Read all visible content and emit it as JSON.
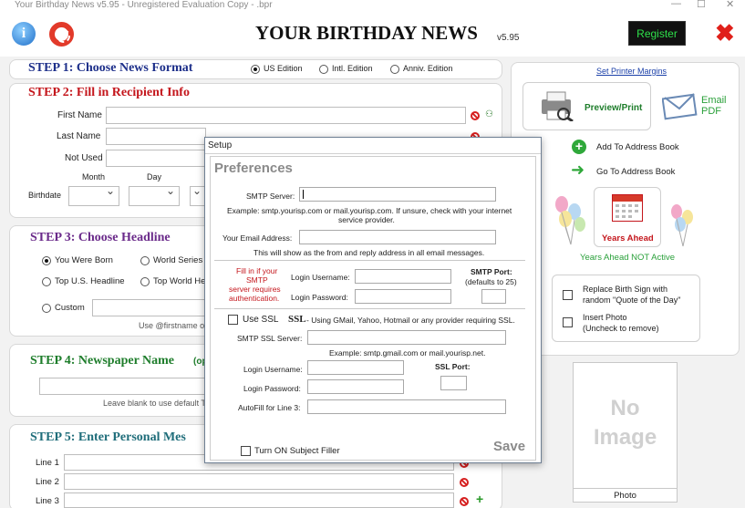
{
  "window": {
    "title": "Your Birthday News v5.95 - Unregistered Evaluation Copy - .bpr"
  },
  "header": {
    "logo": "YOUR BIRTHDAY NEWS",
    "version": "v5.95",
    "register_label": "Register"
  },
  "step1": {
    "title": "STEP 1: Choose News Format",
    "options": [
      "US Edition",
      "Intl. Edition",
      "Anniv. Edition"
    ],
    "selected": "US Edition"
  },
  "step2": {
    "title": "STEP 2: Fill in Recipient Info",
    "first_name": "First Name",
    "last_name": "Last Name",
    "not_used": "Not Used",
    "month": "Month",
    "day": "Day",
    "birthdate": "Birthdate"
  },
  "step3": {
    "title": "STEP 3: Choose Headline",
    "opt_born": "You Were Born",
    "opt_world_series": "World Series",
    "opt_top_us": "Top U.S. Headline",
    "opt_top_world": "Top World He",
    "opt_custom": "Custom",
    "hint": "Use @firstname or"
  },
  "step4": {
    "title": "STEP 4: Newspaper Name",
    "suffix": "(op",
    "hint": "Leave blank to use default T"
  },
  "step5": {
    "title": "STEP 5: Enter Personal Mes",
    "line1": "Line 1",
    "line2": "Line 2",
    "line3": "Line 3"
  },
  "right": {
    "printer_link": "Set Printer Margins",
    "preview": "Preview/Print",
    "email": "Email",
    "pdf": "PDF",
    "add_address": "Add To Address Book",
    "goto_address": "Go To Address Book",
    "years_ahead": "Years Ahead",
    "years_ahead_status": "Years Ahead NOT Active",
    "replace_sign_1": "Replace Birth Sign with",
    "replace_sign_2": "random \"Quote of the Day\"",
    "insert_photo_1": "Insert Photo",
    "insert_photo_2": "(Uncheck to remove)",
    "no_image_1": "No",
    "no_image_2": "Image",
    "photo": "Photo"
  },
  "dialog": {
    "title": "Setup",
    "heading": "Preferences",
    "smtp_server": "SMTP Server:",
    "smtp_server_value": "",
    "smtp_example_1": "Example: smtp.yourisp.com or mail.yourisp.com. If unsure, check with your internet",
    "smtp_example_2": "service provider.",
    "email_address": "Your Email Address:",
    "email_note": "This will show as the from and reply address in all email messages.",
    "auth_note_1": "Fill in if your",
    "auth_note_2": "SMTP",
    "auth_note_3": "server requires",
    "auth_note_4": "authentication.",
    "login_username": "Login Username:",
    "login_password": "Login Password:",
    "smtp_port": "SMTP Port:",
    "smtp_port_default": "(defaults to 25)",
    "use_ssl": "Use SSL",
    "ssl_bold": "SSL",
    "ssl_desc": " - Using GMail, Yahoo, Hotmail or any provider requiring SSL.",
    "smtp_ssl_server": "SMTP SSL Server:",
    "ssl_example": "Example: smtp.gmail.com or mail.yourisp.net.",
    "ssl_login_username": "Login Username:",
    "ssl_login_password": "Login Password:",
    "ssl_port": "SSL Port:",
    "autofill": "AutoFill for Line 3:",
    "subject_filler": "Turn ON Subject Filler",
    "save": "Save"
  },
  "colors": {
    "accent_green": "#2ee04a",
    "close_red": "#e0201a",
    "step2_red": "#c4161c"
  }
}
